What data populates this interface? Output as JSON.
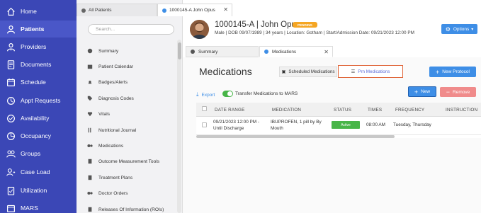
{
  "nav": {
    "items": [
      {
        "label": "Home",
        "icon": "home-icon"
      },
      {
        "label": "Patients",
        "icon": "patients-icon"
      },
      {
        "label": "Providers",
        "icon": "providers-icon"
      },
      {
        "label": "Documents",
        "icon": "documents-icon"
      },
      {
        "label": "Schedule",
        "icon": "calendar-icon"
      },
      {
        "label": "Appt Requests",
        "icon": "clock-icon"
      },
      {
        "label": "Availability",
        "icon": "availability-icon"
      },
      {
        "label": "Occupancy",
        "icon": "occupancy-icon"
      },
      {
        "label": "Groups",
        "icon": "groups-icon"
      },
      {
        "label": "Case Load",
        "icon": "caseload-icon"
      },
      {
        "label": "Utilization",
        "icon": "utilization-icon"
      },
      {
        "label": "MARS",
        "icon": "mars-icon"
      }
    ],
    "active_index": 1
  },
  "tabs": {
    "all_patients": "All Patients",
    "patient_tab": "1000145-A John Opus"
  },
  "search": {
    "placeholder": "Search..."
  },
  "subnav": {
    "items": [
      {
        "label": "Summary",
        "icon": "dashboard-icon"
      },
      {
        "label": "Patient Calendar",
        "icon": "calendar-icon"
      },
      {
        "label": "Badges/Alerts",
        "icon": "bell-icon"
      },
      {
        "label": "Diagnosis Codes",
        "icon": "tag-icon"
      },
      {
        "label": "Vitals",
        "icon": "heart-icon"
      },
      {
        "label": "Nutritional Journal",
        "icon": "utensils-icon"
      },
      {
        "label": "Medications",
        "icon": "pills-icon"
      },
      {
        "label": "Outcome Measurement Tools",
        "icon": "clipboard-icon"
      },
      {
        "label": "Treatment Plans",
        "icon": "document-icon"
      },
      {
        "label": "Doctor Orders",
        "icon": "pills-icon"
      },
      {
        "label": "Releases Of Information (ROIs)",
        "icon": "document-icon"
      }
    ]
  },
  "patient": {
    "name": "1000145-A | John Opus",
    "status": "PENDING",
    "meta": "Male | DOB 09/07/1989 | 34 years | Location: Gotham | Start/Admission Date: 09/21/2023 12:00 PM"
  },
  "header": {
    "options_label": "Options"
  },
  "content_tabs": {
    "summary": "Summary",
    "medications": "Medications"
  },
  "medications": {
    "title": "Medications",
    "scheduled_label": "Scheduled Medications",
    "prn_label": "Prn Medications",
    "new_protocol_label": "New Protocol",
    "export_label": "Export",
    "transfer_label": "Transfer Medications to MARS",
    "new_label": "New",
    "remove_label": "Remove"
  },
  "table": {
    "headers": [
      "DATE RANGE",
      "MEDICATION",
      "STATUS",
      "TIMES",
      "FREQUENCY",
      "INSTRUCTION"
    ],
    "rows": [
      {
        "date_range_1": "09/21/2023 12:00 PM -",
        "date_range_2": "Until Discharge",
        "medication_1": "IBUPROFEN, 1 pill by By",
        "medication_2": "Mouth",
        "status": "Active",
        "times": "08:00 AM",
        "frequency": "Tuesday, Thursday"
      }
    ]
  },
  "colors": {
    "nav_bg": "#3b47b6",
    "accent": "#3e8ee6",
    "pending": "#f5a623",
    "active": "#48b548",
    "remove": "#f08b8b",
    "highlight": "#e0663a"
  }
}
